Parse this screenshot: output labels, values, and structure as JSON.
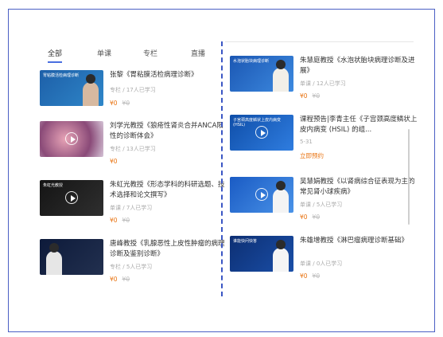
{
  "tabs": [
    {
      "label": "全部",
      "active": true
    },
    {
      "label": "单课",
      "active": false
    },
    {
      "label": "专栏",
      "active": false
    },
    {
      "label": "直播",
      "active": false
    }
  ],
  "left_cards": [
    {
      "title": "张黎《胃粘膜活检病理诊断》",
      "type": "专栏",
      "learners": "17人已学习",
      "price": "¥0",
      "old_price": "¥0",
      "thumb_text": "胃粘膜活检病理诊断"
    },
    {
      "title": "刘学光教授《狼疮性肾炎合并ANCA阳性的诊断体会》",
      "type": "专栏",
      "learners": "13人已学习",
      "price": "¥0",
      "old_price": "",
      "thumb_text": ""
    },
    {
      "title": "朱虹光教授《形态学科的科研选题、技术选择和论文撰写》",
      "type": "单课",
      "learners": "7人已学习",
      "price": "¥0",
      "old_price": "¥0",
      "thumb_text": "朱虹光教授"
    },
    {
      "title": "唐峰教授《乳腺恶性上皮性肿瘤的病理诊断及鉴别诊断》",
      "type": "专栏",
      "learners": "5人已学习",
      "price": "¥0",
      "old_price": "¥0",
      "thumb_text": ""
    }
  ],
  "right_cards": [
    {
      "title": "朱慧庭教授《水泡状胎块病理诊断及进展》",
      "type": "单课",
      "learners": "12人已学习",
      "price": "¥0",
      "old_price": "¥0",
      "thumb_text": "水泡状胎块病理诊断"
    },
    {
      "title": "课程预告|李青主任《子宫颈高度鳞状上皮内病变 (HSIL) 的组...",
      "date": "5-31",
      "action": "立即预约",
      "thumb_text": "子宫颈高度鳞状上皮内病变 (HSIL)"
    },
    {
      "title": "吴慧娟教授《以肾病综合征表现为主的常见肾小球疾病》",
      "type": "单课",
      "learners": "5人已学习",
      "price": "¥0",
      "old_price": "¥0",
      "thumb_text": ""
    },
    {
      "title": "朱雄增教授《淋巴瘤病理诊断基础》",
      "type": "单课",
      "learners": "0人已学习",
      "price": "¥0",
      "old_price": "¥0",
      "thumb_text": "谁能快问快答"
    }
  ],
  "colors": {
    "accent": "#4a6ee0",
    "price": "#e9720f",
    "frame": "#4a5fc4"
  }
}
